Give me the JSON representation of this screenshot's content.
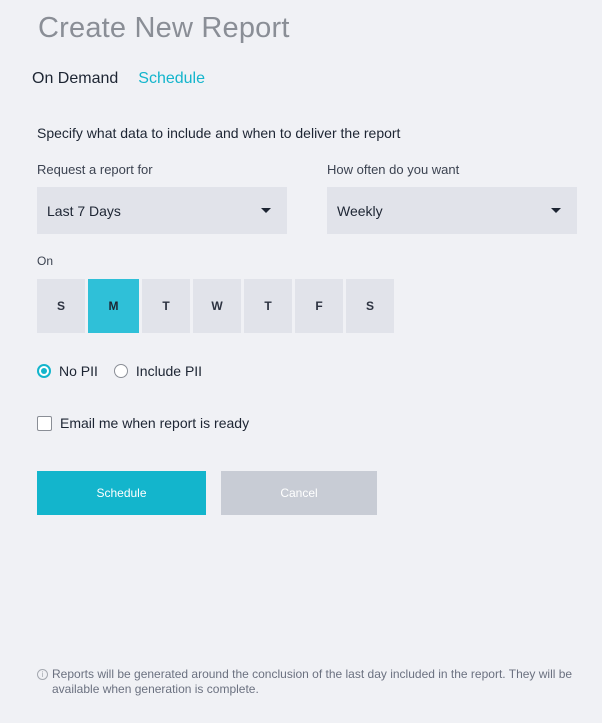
{
  "header": {
    "title": "Create New Report"
  },
  "tabs": [
    {
      "label": "On Demand",
      "active": false
    },
    {
      "label": "Schedule",
      "active": true
    }
  ],
  "form": {
    "subtitle": "Specify what data to include and when to deliver the report",
    "report_for": {
      "label": "Request a report for",
      "value": "Last 7 Days"
    },
    "frequency": {
      "label": "How often do you want",
      "value": "Weekly"
    },
    "on": {
      "label": "On",
      "days": [
        {
          "label": "S",
          "selected": false
        },
        {
          "label": "M",
          "selected": true
        },
        {
          "label": "T",
          "selected": false
        },
        {
          "label": "W",
          "selected": false
        },
        {
          "label": "T",
          "selected": false
        },
        {
          "label": "F",
          "selected": false
        },
        {
          "label": "S",
          "selected": false
        }
      ]
    },
    "pii": {
      "options": [
        {
          "label": "No PII",
          "checked": true
        },
        {
          "label": "Include PII",
          "checked": false
        }
      ]
    },
    "email_notify": {
      "label": "Email me when report is ready",
      "checked": false
    }
  },
  "actions": {
    "schedule_label": "Schedule",
    "cancel_label": "Cancel"
  },
  "footnote": {
    "icon": "info-icon",
    "text": "Reports will be generated around the conclusion of the last day included in the report. They will be available when generation is complete."
  },
  "colors": {
    "accent": "#13b5cc",
    "selected_day": "#2fc0d8",
    "background": "#f0f1f5",
    "control": "#e1e3ea",
    "disabled_button": "#c8ccd5"
  }
}
